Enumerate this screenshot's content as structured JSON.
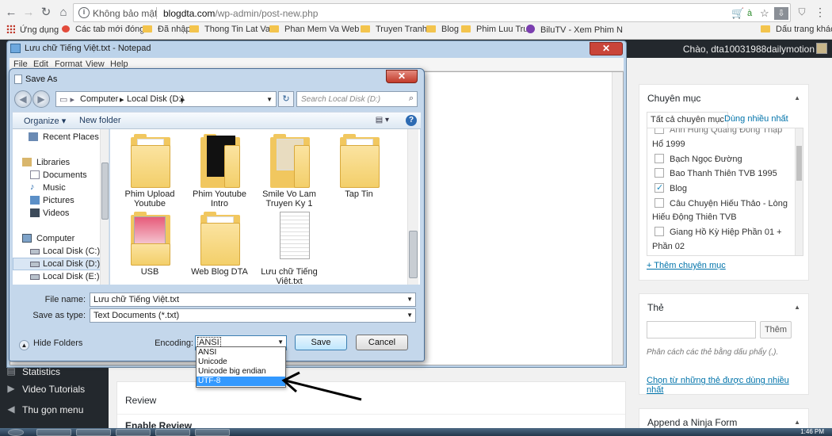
{
  "browser": {
    "secure_label": "Không bảo mật",
    "url_host": "blogdta.com",
    "url_path": "/wp-admin/post-new.php",
    "bookmarks": [
      {
        "label": "Ứng dụng"
      },
      {
        "label": "Các tab mới đóng"
      },
      {
        "label": "Đã nhập"
      },
      {
        "label": "Thong Tin Lat Vat"
      },
      {
        "label": "Phan Mem Va Web L"
      },
      {
        "label": "Truyen Tranh"
      },
      {
        "label": "Blog"
      },
      {
        "label": "Phim Luu Tru"
      },
      {
        "label": "BiluTV - Xem Phim N"
      },
      {
        "label": "Dấu trang khác"
      }
    ]
  },
  "wp": {
    "howdy": "Chào, dta10031988dailymotion",
    "menu": [
      {
        "label": "Statistics"
      },
      {
        "label": "Video Tutorials"
      },
      {
        "label": "Thu gọn menu"
      }
    ],
    "categories_box": {
      "title": "Chuyên mục",
      "tab_all": "Tất cả chuyên mục",
      "tab_popular": "Dùng nhiều nhất",
      "items": [
        {
          "label": "Anh Hùng Quang Đông Thập",
          "checked": false
        },
        {
          "label": "Hổ 1999",
          "checked": false
        },
        {
          "label": "Bạch Ngọc Đường",
          "checked": false
        },
        {
          "label": "Bao Thanh Thiên TVB 1995",
          "checked": false
        },
        {
          "label": "Blog",
          "checked": true
        },
        {
          "label": "Câu Chuyện Hiếu Thảo - Lòng",
          "checked": false
        },
        {
          "label": "Hiếu Động Thiên TVB",
          "checked": false
        },
        {
          "label": "Giang Hồ Kỳ Hiệp Phần 01 +",
          "checked": false
        },
        {
          "label": "Phần 02",
          "checked": false
        }
      ],
      "add_link": "+ Thêm chuyên mục"
    },
    "tags_box": {
      "title": "Thẻ",
      "add_button": "Thêm",
      "hint": "Phân cách các thẻ bằng dấu phẩy (,).",
      "choose_link": "Chọn từ những thẻ được dùng nhiều nhất"
    },
    "review_box": {
      "title": "Review",
      "enable_label": "Enable Review"
    },
    "ninja_box": {
      "title": "Append a Ninja Form"
    }
  },
  "notepad": {
    "title": "Lưu chữ Tiếng Việt.txt - Notepad",
    "menus": [
      "File",
      "Edit",
      "Format",
      "View",
      "Help"
    ]
  },
  "save_as": {
    "title": "Save As",
    "path": [
      "Computer",
      "Local Disk (D:)"
    ],
    "search_placeholder": "Search Local Disk (D:)",
    "organize": "Organize ▾",
    "new_folder": "New folder",
    "nav": [
      {
        "label": "Recent Places",
        "icon": "recent-places-icon"
      },
      {
        "label": "Libraries",
        "icon": "libraries-icon"
      },
      {
        "label": "Documents",
        "icon": "documents-icon"
      },
      {
        "label": "Music",
        "icon": "music-icon"
      },
      {
        "label": "Pictures",
        "icon": "pictures-icon"
      },
      {
        "label": "Videos",
        "icon": "videos-icon"
      },
      {
        "label": "Computer",
        "icon": "computer-icon"
      },
      {
        "label": "Local Disk (C:)",
        "icon": "drive-icon"
      },
      {
        "label": "Local Disk (D:)",
        "icon": "drive-icon",
        "selected": true
      },
      {
        "label": "Local Disk (E:)",
        "icon": "drive-icon"
      }
    ],
    "files": [
      {
        "label": "Phim Upload Youtube"
      },
      {
        "label": "Phim Youtube Intro"
      },
      {
        "label": "Smile Vo Lam Truyen Ky 1"
      },
      {
        "label": "Tap Tin"
      },
      {
        "label": "USB"
      },
      {
        "label": "Web Blog DTA"
      },
      {
        "label": "Lưu chữ Tiếng Việt.txt"
      }
    ],
    "file_name_label": "File name:",
    "file_name_value": "Lưu chữ Tiếng Việt.txt",
    "save_type_label": "Save as type:",
    "save_type_value": "Text Documents (*.txt)",
    "hide_folders": "Hide Folders",
    "encoding_label": "Encoding:",
    "encoding_value": "ANSI",
    "encoding_options": [
      "ANSI",
      "Unicode",
      "Unicode big endian",
      "UTF-8"
    ],
    "encoding_highlighted": "UTF-8",
    "save_button": "Save",
    "cancel_button": "Cancel"
  },
  "taskbar": {
    "clock": "1:46 PM"
  }
}
